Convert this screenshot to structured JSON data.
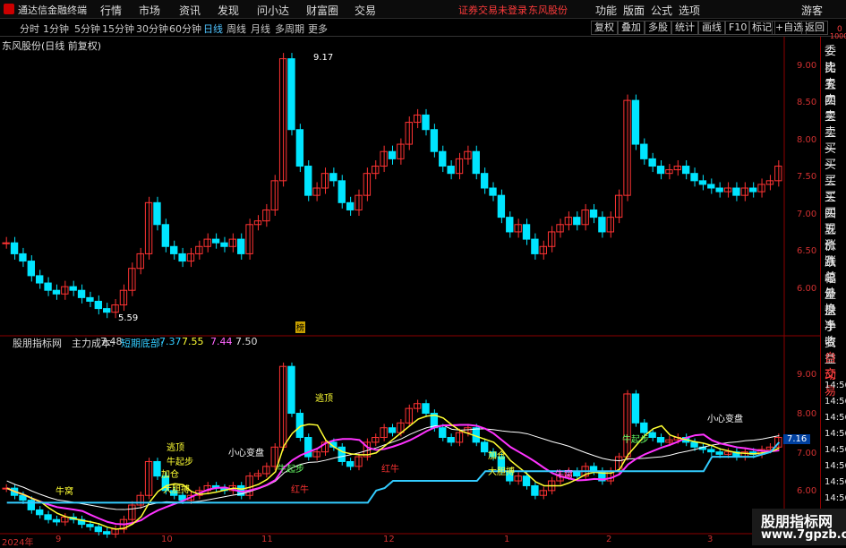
{
  "menubar": {
    "title": "通达信金融终端",
    "items": [
      "行情",
      "市场",
      "资讯",
      "发现",
      "问小达",
      "财富圈",
      "交易"
    ],
    "warning": "证券交易未登录",
    "stock": "东风股份",
    "right_items": [
      "功能",
      "版面",
      "公式",
      "选项"
    ],
    "guest": "游客"
  },
  "periods": [
    "分时",
    "1分钟",
    "5分钟",
    "15分钟",
    "30分钟",
    "60分钟",
    "日线",
    "周线",
    "月线",
    "多周期",
    "更多"
  ],
  "active_period": "日线",
  "toolbar": [
    "复权",
    "叠加",
    "多股",
    "统计",
    "画线",
    "F10",
    "标记",
    "+自选",
    "返回"
  ],
  "main_chart": {
    "title": "东风股份(日线 前复权)",
    "high_label": "9.17",
    "low_label": "5.59",
    "marker": "榜"
  },
  "indicator": {
    "name": "股朋指标网",
    "main_cost_label": "主力成本:",
    "main_cost": "7.48",
    "short_bottom_label": "短期底部:",
    "v1": "7.37",
    "v2": "7.55",
    "v3": "7.44",
    "v4": "7.50",
    "current_price": "7.16"
  },
  "signals": {
    "top1": "逃顶",
    "top2": "逃顶",
    "start1": "牛起步",
    "start2": "牛起步",
    "start3": "牛起步",
    "add1": "加仓",
    "add2": "加仓",
    "bet1": "大胆搏",
    "bet2": "大胆搏",
    "bull1": "红牛",
    "bull2": "红牛",
    "nest": "牛窝",
    "nest2": "牛窝",
    "caution1": "小心变盘",
    "caution2": "小心变盘"
  },
  "right_panel": [
    "委比",
    "卖五",
    "卖四",
    "卖三",
    "卖二",
    "卖一",
    "买一",
    "买二",
    "买三",
    "买四",
    "买五",
    "现价",
    "涨跌",
    "涨幅",
    "总量",
    "外盘",
    "换手",
    "净资",
    "收益",
    "自动",
    "交易"
  ],
  "right_panel_top": "0",
  "right_panel_top2": "1000",
  "price_axis": [
    "9.00",
    "8.50",
    "8.00",
    "7.50",
    "7.00",
    "6.50",
    "6.00"
  ],
  "ind_axis": [
    "9.00",
    "8.00",
    "7.00",
    "6.00"
  ],
  "time_panel": [
    "14:56",
    "14:56",
    "14:56",
    "14:56",
    "14:56",
    "14:56",
    "14:56",
    "14:56"
  ],
  "x_axis": [
    "2024年",
    "9",
    "10",
    "11",
    "12",
    "1",
    "2",
    "3"
  ],
  "watermark": {
    "line1": "股朋指标网",
    "line2": "www.7gpzb.com"
  },
  "colors": {
    "up": "#ff3333",
    "down": "#00e5ff",
    "cost_line": "#ff33ff",
    "short_line": "#ffff33",
    "bottom_line": "#33ccff",
    "avg_line": "#ffffff"
  },
  "chart_data": {
    "type": "candlestick",
    "ylim": [
      5.5,
      9.3
    ],
    "series": [
      {
        "values": [
          6.65,
          6.5,
          6.4,
          6.2,
          6.1,
          6.0,
          5.95,
          6.05,
          6.0,
          5.9,
          5.85,
          5.75,
          5.7,
          5.8,
          6.0,
          6.3,
          6.5,
          7.2,
          6.9,
          6.6,
          6.5,
          6.4,
          6.5,
          6.6,
          6.7,
          6.65,
          6.6,
          6.7,
          6.5,
          6.9,
          6.95,
          7.1,
          7.5,
          9.17,
          8.2,
          7.7,
          7.3,
          7.4,
          7.6,
          7.5,
          7.2,
          7.1,
          7.3,
          7.6,
          7.7,
          7.9,
          7.8,
          8.0,
          8.3,
          8.4,
          8.2,
          7.9,
          7.7,
          7.6,
          7.8,
          7.9,
          7.6,
          7.4,
          7.3,
          7.0,
          6.8,
          6.9,
          6.7,
          6.5,
          6.6,
          6.8,
          6.9,
          7.0,
          6.9,
          7.1,
          7.0,
          6.8,
          7.0,
          7.3,
          8.6,
          8.0,
          7.8,
          7.7,
          7.6,
          7.65,
          7.7,
          7.6,
          7.5,
          7.45,
          7.4,
          7.35,
          7.4,
          7.3,
          7.4,
          7.35,
          7.45,
          7.5,
          7.7
        ]
      }
    ]
  }
}
